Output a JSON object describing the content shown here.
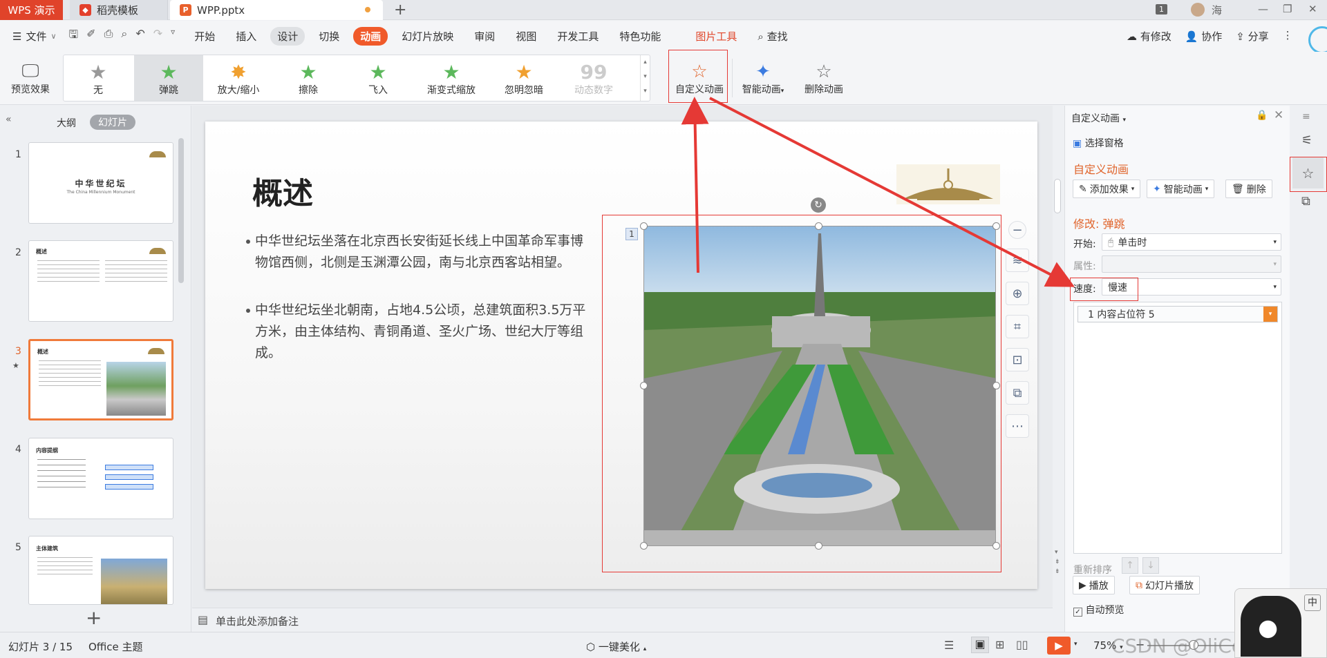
{
  "titlebar": {
    "app_tab": "WPS 演示",
    "template_tab": "稻壳模板",
    "file_tab": "WPP.pptx",
    "page_indicator": "1",
    "user_name": "海"
  },
  "menu": {
    "file": "文件",
    "items": [
      "开始",
      "插入",
      "设计",
      "切换",
      "动画",
      "幻灯片放映",
      "审阅",
      "视图",
      "开发工具",
      "特色功能"
    ],
    "picture_tools": "图片工具",
    "search": "查找",
    "modified": "有修改",
    "collaborate": "协作",
    "share": "分享"
  },
  "ribbon": {
    "preview": "预览效果",
    "gallery": [
      "无",
      "弹跳",
      "放大/缩小",
      "擦除",
      "飞入",
      "渐变式缩放",
      "忽明忽暗",
      "动态数字"
    ],
    "custom_animation": "自定义动画",
    "smart_animation": "智能动画",
    "delete_animation": "删除动画"
  },
  "leftpanel": {
    "tab_outline": "大纲",
    "tab_slides": "幻灯片",
    "slides": [
      {
        "num": "1",
        "title": "中华世纪坛",
        "subtitle": "The China Millennium Monument"
      },
      {
        "num": "2",
        "title": "概述"
      },
      {
        "num": "3",
        "title": "概述"
      },
      {
        "num": "4",
        "title": "内容提纲"
      },
      {
        "num": "5",
        "title": "主体建筑"
      }
    ],
    "add_slide": "+"
  },
  "slide": {
    "title": "概述",
    "bullet1": "中华世纪坛坐落在北京西长安街延长线上中国革命军事博物馆西侧，北侧是玉渊潭公园，南与北京西客站相望。",
    "bullet2": "中华世纪坛坐北朝南，占地4.5公顷，总建筑面积3.5万平方米，由主体结构、青铜甬道、圣火广场、世纪大厅等组成。",
    "anim_tag": "1"
  },
  "notes": {
    "placeholder": "单击此处添加备注"
  },
  "rightpanel": {
    "header": "自定义动画",
    "select_pane": "选择窗格",
    "section_title": "自定义动画",
    "add_effect": "添加效果",
    "smart_anim": "智能动画",
    "delete": "删除",
    "modify": "修改: 弹跳",
    "start_label": "开始:",
    "start_value": "单击时",
    "property_label": "属性:",
    "speed_label": "速度:",
    "speed_value": "慢速",
    "list_item": "1     内容占位符 5",
    "reorder": "重新排序",
    "play": "播放",
    "slideshow": "幻灯片播放",
    "auto_preview": "自动预览"
  },
  "statusbar": {
    "slide_info": "幻灯片 3 / 15",
    "theme": "Office 主题",
    "beautify": "一键美化",
    "zoom": "75%",
    "watermark": "CSDN @OliCorrect"
  },
  "colors": {
    "accent": "#f05a2a",
    "annotation": "#e53935"
  }
}
